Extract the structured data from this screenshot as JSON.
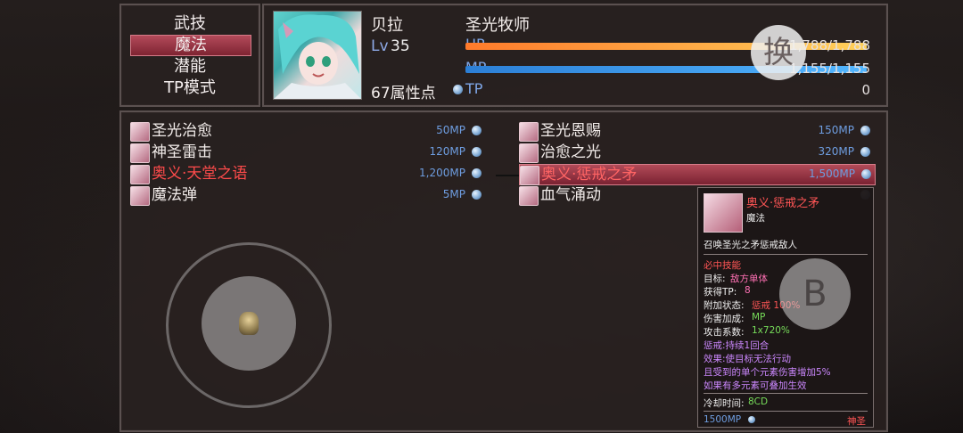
{
  "menu": {
    "items": [
      {
        "label": "武技"
      },
      {
        "label": "魔法"
      },
      {
        "label": "潜能"
      },
      {
        "label": "TP模式"
      }
    ],
    "active_index": 1
  },
  "character": {
    "name": "贝拉",
    "class": "圣光牧师",
    "level_label": "Lv",
    "level": "35",
    "attribute_points": "67属性点",
    "hp_label": "HP",
    "hp_value": "1,788/1,788",
    "mp_label": "MP",
    "mp_value": "1,155/1,155",
    "tp_label": "TP",
    "tp_value": "0",
    "hp_fraction": 1.0,
    "mp_fraction": 1.0
  },
  "swap_button": {
    "label": "换"
  },
  "skills_left": [
    {
      "name": "圣光治愈",
      "cost": "50MP",
      "icon": "holy-heal-icon"
    },
    {
      "name": "神圣雷击",
      "cost": "120MP",
      "icon": "holy-thunder-icon"
    },
    {
      "name": "奥义·天堂之语",
      "cost": "1,200MP",
      "icon": "heaven-word-icon"
    },
    {
      "name": "魔法弹",
      "cost": "5MP",
      "icon": "magic-bullet-icon"
    }
  ],
  "skills_right": [
    {
      "name": "圣光恩赐",
      "cost": "150MP",
      "icon": "holy-grace-icon"
    },
    {
      "name": "治愈之光",
      "cost": "320MP",
      "icon": "healing-light-icon"
    },
    {
      "name": "奥义·惩戒之矛",
      "cost": "1,500MP",
      "icon": "punish-spear-icon"
    },
    {
      "name": "血气涌动",
      "cost": "",
      "icon": "blood-surge-icon"
    }
  ],
  "tooltip": {
    "name": "奥义·惩戒之矛",
    "type": "魔法",
    "description": "召唤圣光之矛惩戒敌人",
    "tag": "必中技能",
    "target_label": "目标:",
    "target_value": "敌方单体",
    "tp_label": "获得TP:",
    "tp_value": "8",
    "status_label": "附加状态:",
    "status_value": "惩戒 100%",
    "bonus_label": "伤害加成:",
    "bonus_value": "MP",
    "coef_label": "攻击系数:",
    "coef_value": "1x720%",
    "effect_1": "惩戒:持续1回合",
    "effect_2": "效果:使目标无法行动",
    "effect_3": "且受到的单个元素伤害增加5%",
    "effect_4": "如果有多元素可叠加生效",
    "cooldown_label": "冷却时间:",
    "cooldown_value": "8CD",
    "cost": "1500MP",
    "element": "神圣"
  },
  "b_button": {
    "label": "B"
  },
  "colors": {
    "accent_red": "#ff5555",
    "mp_blue": "#6e9de0",
    "hp_orange": "#ff7a2b",
    "selection": "#b24b58"
  }
}
